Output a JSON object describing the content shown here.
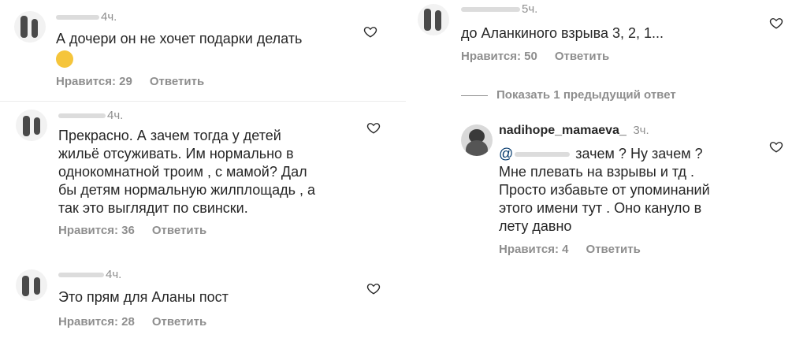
{
  "comments_left": [
    {
      "time": "4ч.",
      "text_lines": [
        "А дочери он не хочет подарки делать"
      ],
      "emoji": "😂",
      "likes": "Нравится: 29",
      "reply": "Ответить"
    },
    {
      "time": "4ч.",
      "text_lines": [
        "Прекрасно. А зачем тогда у детей",
        "жильё отсуживать. Им нормально в",
        "однокомнатной троим , с мамой? Дал",
        "бы детям нормальную жилплощадь , а",
        "так это выглядит по свински."
      ],
      "likes": "Нравится: 36",
      "reply": "Ответить"
    },
    {
      "time": "4ч.",
      "text_lines": [
        "Это прям для Аланы пост"
      ],
      "likes": "Нравится: 28",
      "reply": "Ответить"
    }
  ],
  "comments_right": [
    {
      "time": "5ч.",
      "text_lines": [
        "до Аланкиного взрыва 3, 2, 1..."
      ],
      "likes": "Нравится: 50",
      "reply": "Ответить"
    }
  ],
  "show_replies": "Показать 1 предыдущий ответ",
  "reply_comment": {
    "username": "nadihope_mamaeva_",
    "time": "3ч.",
    "mention": "@",
    "first_line_rest": "зачем ? Ну зачем ?",
    "text_lines": [
      "Мне плевать на взрывы и тд .",
      "Просто избавьте от упоминаний",
      "этого имени тут . Оно кануло в",
      "лету давно"
    ],
    "likes": "Нравится: 4",
    "reply": "Ответить"
  },
  "icons": {
    "like": "heart-outline-icon",
    "avatar_placeholder": "avatar-icon"
  },
  "colors": {
    "text": "#262626",
    "muted": "#8e8e8e",
    "mention": "#00376b",
    "background": "#ffffff"
  }
}
